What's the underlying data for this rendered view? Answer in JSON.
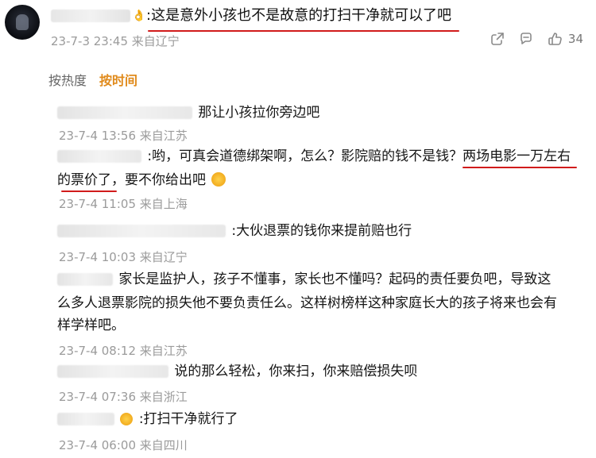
{
  "top_comment": {
    "text": ":这是意外小孩也不是故意的打扫干净就可以了吧",
    "timestamp": "23-7-3 23:45",
    "location": "来自辽宁",
    "actions": {
      "share_icon": "share-icon",
      "comment_icon": "comment-icon",
      "like_icon": "thumbs-up-icon",
      "like_count": "34"
    }
  },
  "tabs": {
    "hot_label": "按热度",
    "time_label": "按时间",
    "active": "time"
  },
  "replies": [
    {
      "text": "那让小孩拉你旁边吧",
      "timestamp": "23-7-4 13:56",
      "location": "来自江苏"
    },
    {
      "text_line1": ":哟，可真会道德绑架啊，怎么？影院赔的钱不是钱？两场电影一万左右",
      "text_line2": "的票价了，要不你给出吧",
      "timestamp": "23-7-4 11:05",
      "location": "来自上海"
    },
    {
      "text": ":大伙退票的钱你来提前赔也行",
      "timestamp": "23-7-4 10:03",
      "location": "来自辽宁"
    },
    {
      "text_line1": "家长是监护人，孩子不懂事，家长也不懂吗？起码的责任要负吧，导致这",
      "text_line2": "么多人退票影院的损失他不要负责任么。这样树榜样这种家庭长大的孩子将来也会有",
      "text_line3": "样学样吧。",
      "timestamp": "23-7-4 08:12",
      "location": "来自江苏"
    },
    {
      "text": "说的那么轻松，你来扫，你来赔偿损失呗",
      "timestamp": "23-7-4 07:36",
      "location": "来自浙江"
    },
    {
      "text": ":打扫干净就行了",
      "timestamp": "23-7-4 06:00",
      "location": "来自四川"
    }
  ]
}
